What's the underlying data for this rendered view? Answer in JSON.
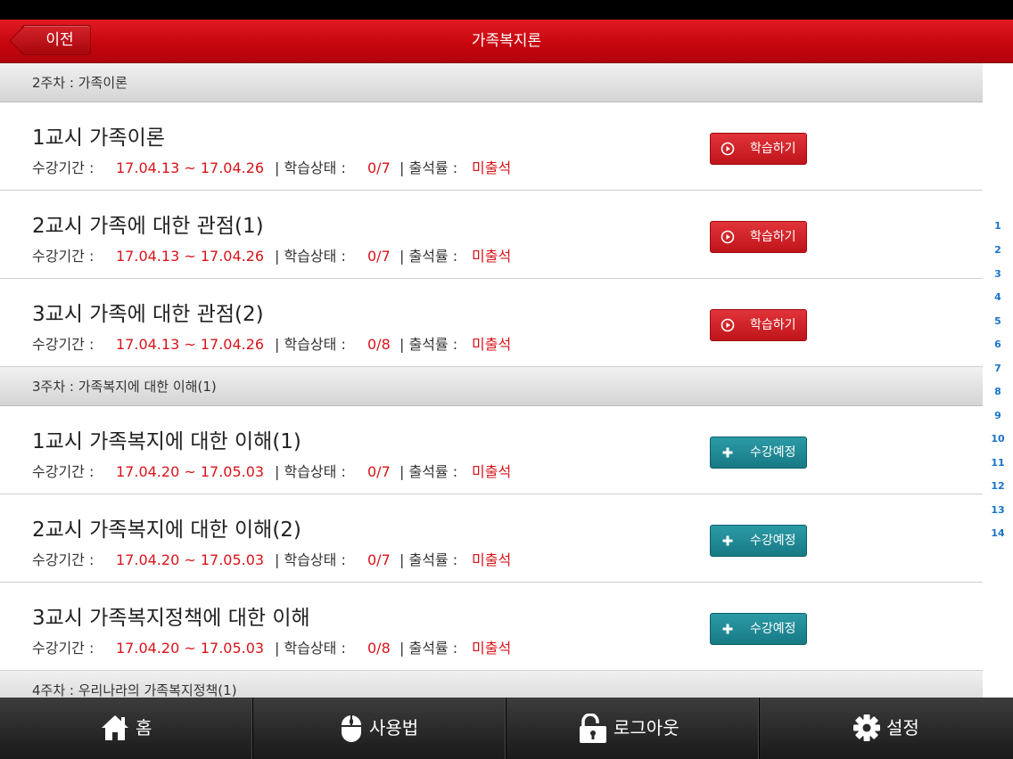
{
  "header": {
    "back_label": "이전",
    "title": "가족복지론"
  },
  "weeks": [
    {
      "label": "2주차 : 가족이론"
    },
    {
      "label": "3주차 : 가족복지에 대한 이해(1)"
    },
    {
      "label": "4주차 : 우리나라의 가족복지정책(1)"
    }
  ],
  "lessons": [
    {
      "title": "1교시 가족이론",
      "period_label": "수강기간 :",
      "period": "17.04.13 ~ 17.04.26",
      "status_label": "| 학습상태 :",
      "status": "0/7",
      "attend_label": "| 출석률 :",
      "attend": "미출석",
      "button": "학습하기"
    },
    {
      "title": "2교시 가족에 대한 관점(1)",
      "period_label": "수강기간 :",
      "period": "17.04.13 ~ 17.04.26",
      "status_label": "| 학습상태 :",
      "status": "0/7",
      "attend_label": "| 출석률 :",
      "attend": "미출석",
      "button": "학습하기"
    },
    {
      "title": "3교시 가족에 대한 관점(2)",
      "period_label": "수강기간 :",
      "period": "17.04.13 ~ 17.04.26",
      "status_label": "| 학습상태 :",
      "status": "0/8",
      "attend_label": "| 출석률 :",
      "attend": "미출석",
      "button": "학습하기"
    },
    {
      "title": "1교시 가족복지에 대한 이해(1)",
      "period_label": "수강기간 :",
      "period": "17.04.20 ~ 17.05.03",
      "status_label": "| 학습상태 :",
      "status": "0/7",
      "attend_label": "| 출석률 :",
      "attend": "미출석",
      "button": "수강예정"
    },
    {
      "title": "2교시 가족복지에 대한 이해(2)",
      "period_label": "수강기간 :",
      "period": "17.04.20 ~ 17.05.03",
      "status_label": "| 학습상태 :",
      "status": "0/7",
      "attend_label": "| 출석률 :",
      "attend": "미출석",
      "button": "수강예정"
    },
    {
      "title": "3교시 가족복지정책에 대한 이해",
      "period_label": "수강기간 :",
      "period": "17.04.20 ~ 17.05.03",
      "status_label": "| 학습상태 :",
      "status": "0/8",
      "attend_label": "| 출석률 :",
      "attend": "미출석",
      "button": "수강예정"
    }
  ],
  "week_index": [
    "1",
    "2",
    "3",
    "4",
    "5",
    "6",
    "7",
    "8",
    "9",
    "10",
    "11",
    "12",
    "13",
    "14"
  ],
  "tabbar": {
    "home": "홈",
    "howto": "사용법",
    "logout": "로그아웃",
    "settings": "설정"
  },
  "colors": {
    "primary_red": "#c5050d",
    "date_red": "#d7141a",
    "study_button": "#c0141b",
    "planned_button": "#177a85",
    "index_blue": "#1a73c9"
  },
  "icons": {
    "study": "play-circle-icon",
    "planned": "plus-icon",
    "home": "home-icon",
    "howto": "mouse-icon",
    "logout": "unlock-icon",
    "settings": "gear-icon"
  }
}
